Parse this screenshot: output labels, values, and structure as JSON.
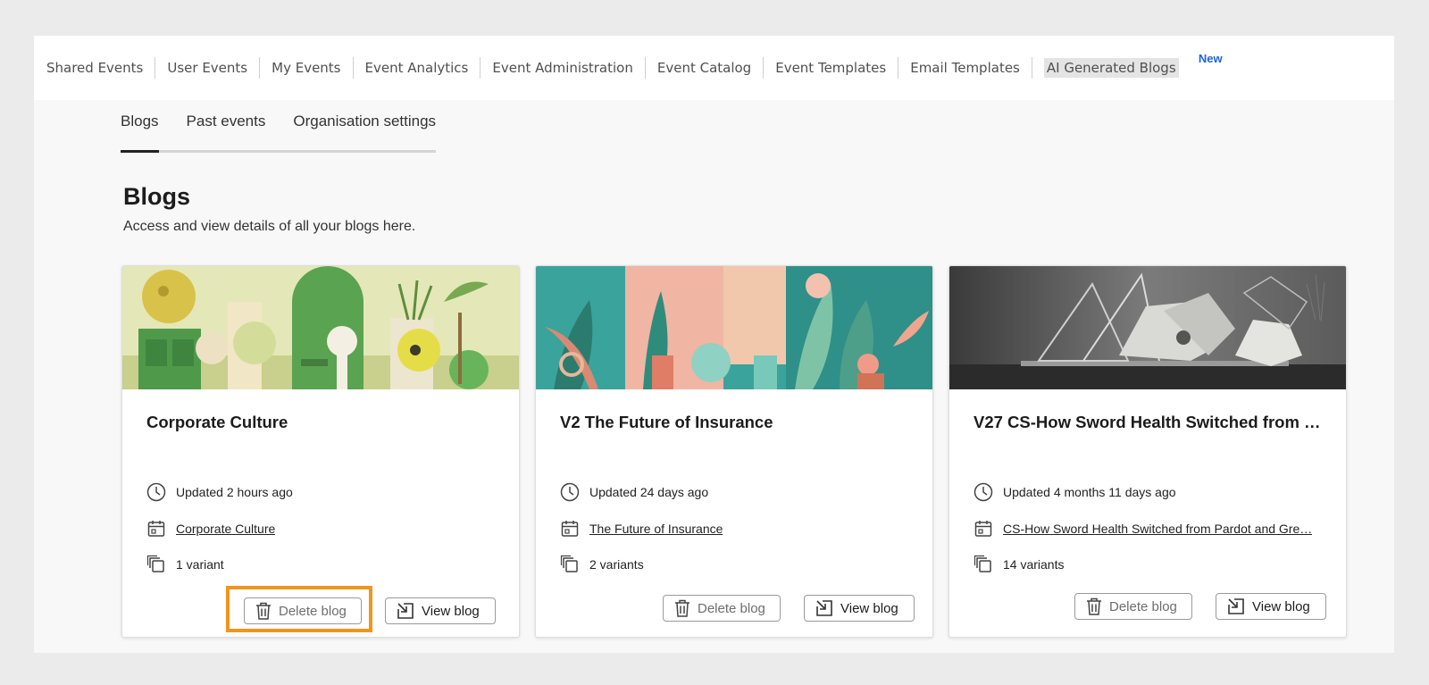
{
  "topnav": {
    "items": [
      "Shared Events",
      "User Events",
      "My Events",
      "Event Analytics",
      "Event Administration",
      "Event Catalog",
      "Event Templates",
      "Email Templates",
      "AI Generated Blogs"
    ],
    "new_badge": "New"
  },
  "subtabs": [
    "Blogs",
    "Past events",
    "Organisation settings"
  ],
  "page": {
    "title": "Blogs",
    "subtitle": "Access and view details of all your blogs here."
  },
  "cards": [
    {
      "title": "Corporate Culture",
      "updated": "Updated 2 hours ago",
      "event_link": "Corporate Culture",
      "variants": "1 variant",
      "delete_label": "Delete blog",
      "view_label": "View blog"
    },
    {
      "title": "V2 The Future of Insurance",
      "updated": "Updated 24 days ago",
      "event_link": "The Future of Insurance",
      "variants": "2 variants",
      "delete_label": "Delete blog",
      "view_label": "View blog"
    },
    {
      "title": "V27 CS-How Sword Health Switched from …",
      "updated": "Updated 4 months 11 days ago",
      "event_link": "CS-How Sword Health Switched from Pardot and Gre…",
      "variants": "14 variants",
      "delete_label": "Delete blog",
      "view_label": "View blog"
    }
  ],
  "colors": {
    "highlight": "#f0951f",
    "new_badge": "#1d65d8"
  }
}
